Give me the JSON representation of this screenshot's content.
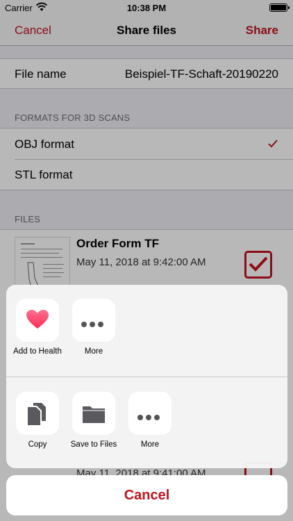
{
  "status_bar": {
    "carrier": "Carrier",
    "time": "10:38 PM"
  },
  "nav": {
    "cancel_label": "Cancel",
    "title": "Share files",
    "share_label": "Share"
  },
  "file_name": {
    "label": "File name",
    "value": "Beispiel-TF-Schaft-20190220"
  },
  "formats_section": {
    "header": "FORMATS FOR 3D SCANS",
    "items": [
      {
        "label": "OBJ format",
        "checked": true
      },
      {
        "label": "STL format",
        "checked": false
      }
    ]
  },
  "files_section": {
    "header": "FILES",
    "items": [
      {
        "title": "Order Form TF",
        "date": "May 11, 2018 at 9:42:00 AM",
        "selected": true
      },
      {
        "title": "",
        "date": "May 11, 2018 at 9:41:00 AM",
        "selected": true
      }
    ]
  },
  "share_sheet": {
    "apps": [
      {
        "label": "Add to Health",
        "icon": "heart-icon"
      },
      {
        "label": "More",
        "icon": "more-icon"
      }
    ],
    "actions": [
      {
        "label": "Copy",
        "icon": "copy-icon"
      },
      {
        "label": "Save to Files",
        "icon": "folder-icon"
      },
      {
        "label": "More",
        "icon": "more-icon"
      }
    ],
    "cancel_label": "Cancel"
  },
  "colors": {
    "accent": "#c1121f",
    "background": "#efeff4"
  }
}
